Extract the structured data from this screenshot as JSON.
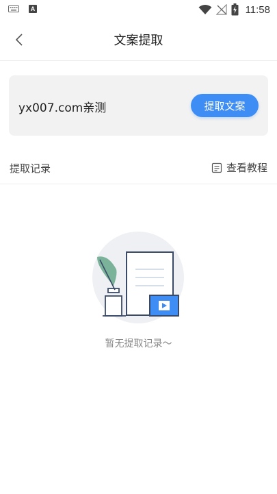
{
  "status_bar": {
    "time": "11:58",
    "left_icons": [
      "keyboard-icon",
      "a-icon"
    ],
    "a_icon_text": "A",
    "right_icons": [
      "wifi-icon",
      "no-signal-icon",
      "battery-charging-icon"
    ]
  },
  "nav": {
    "title": "文案提取",
    "back_icon": "chevron-left-icon"
  },
  "card": {
    "link_text": "yx007.com亲测",
    "button_label": "提取文案"
  },
  "records": {
    "title": "提取记录",
    "tutorial_label": "查看教程",
    "tutorial_icon": "document-icon"
  },
  "empty_state": {
    "message": "暂无提取记录～",
    "illustration_icon": "document-quill-video-illustration"
  },
  "colors": {
    "accent": "#3d8df5",
    "card_bg": "#f2f2f2",
    "divider": "#ececec"
  }
}
